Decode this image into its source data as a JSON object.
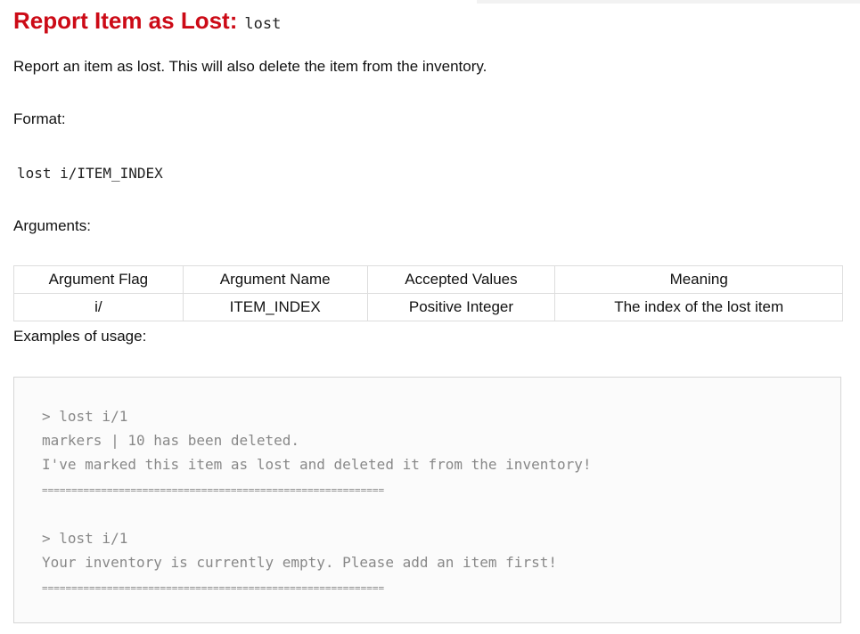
{
  "section": {
    "title": "Report Item as Lost:",
    "command": "lost",
    "description": "Report an item as lost. This will also delete the item from the inventory.",
    "format_label": "Format:",
    "format_code": "lost i/ITEM_INDEX",
    "arguments_label": "Arguments:",
    "examples_label": "Examples of usage:"
  },
  "arguments_table": {
    "headers": [
      "Argument Flag",
      "Argument Name",
      "Accepted Values",
      "Meaning"
    ],
    "rows": [
      [
        "i/",
        "ITEM_INDEX",
        "Positive Integer",
        "The index of the lost item"
      ]
    ]
  },
  "examples": {
    "lines": [
      "> lost i/1",
      "markers | 10 has been deleted.",
      "I've marked this item as lost and deleted it from the inventory!",
      "==========================================================",
      "",
      "> lost i/1",
      "Your inventory is currently empty. Please add an item first!",
      "=========================================================="
    ]
  }
}
